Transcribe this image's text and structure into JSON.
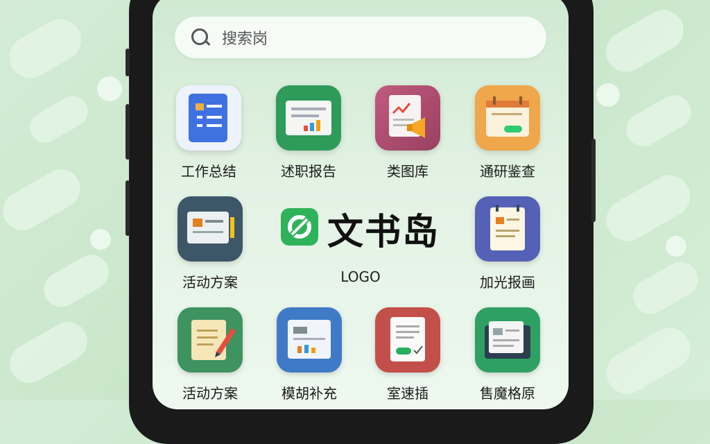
{
  "search": {
    "placeholder": "搜索岗"
  },
  "apps": [
    {
      "id": "work-summary",
      "label": "工作总结",
      "tile_color": "#e9eef8"
    },
    {
      "id": "report",
      "label": "述职报告",
      "tile_color": "#2e9b5a"
    },
    {
      "id": "library",
      "label": "类图库",
      "tile_color": "#b04d6e"
    },
    {
      "id": "research",
      "label": "通研鉴查",
      "tile_color": "#f0a64a"
    },
    {
      "id": "activity-plan-1",
      "label": "活动方案",
      "tile_color": "#3d5668"
    },
    {
      "id": "photo",
      "label": "加光报画",
      "tile_color": "#5561b6"
    },
    {
      "id": "activity-plan-2",
      "label": "活动方案",
      "tile_color": "#3e9360"
    },
    {
      "id": "template",
      "label": "模胡补充",
      "tile_color": "#3f7ac7"
    },
    {
      "id": "contract",
      "label": "室速插",
      "tile_color": "#c34f4a"
    },
    {
      "id": "archive",
      "label": "售魔格原",
      "tile_color": "#2fa063"
    }
  ],
  "logo": {
    "title": "文书岛",
    "subtitle": "LOGO"
  }
}
